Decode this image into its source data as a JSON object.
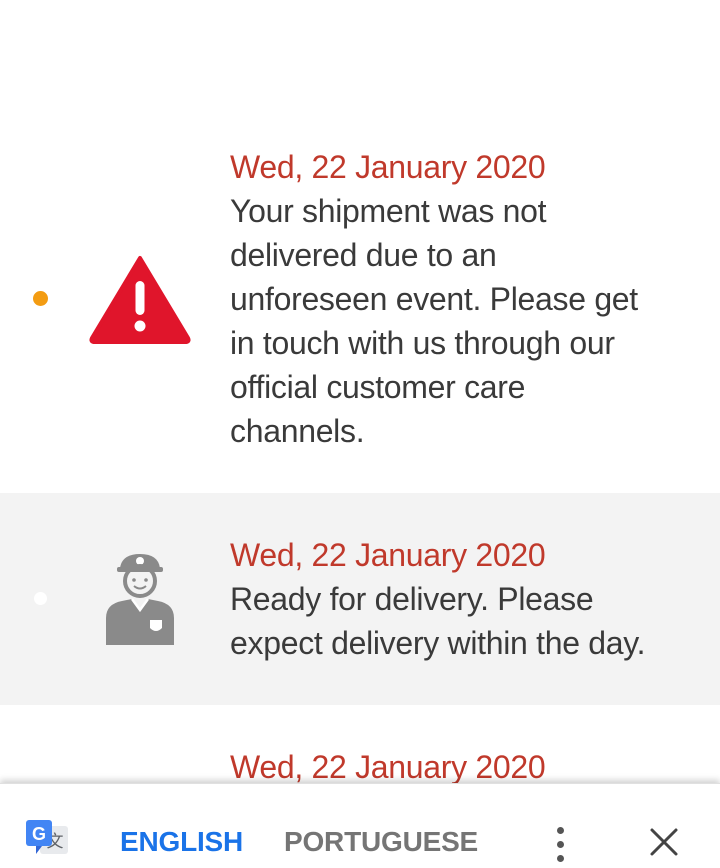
{
  "events": [
    {
      "date": "Wed, 22 January 2020",
      "lines": [
        "Your shipment was not",
        "delivered due to an",
        "unforeseen event. Please get",
        "in touch with us through our",
        "official customer care",
        "channels."
      ],
      "icon": "warning-icon",
      "active": true
    },
    {
      "date": "Wed, 22 January 2020",
      "lines": [
        "Ready for delivery. Please",
        "expect delivery within the day."
      ],
      "icon": "courier-icon",
      "active": false
    },
    {
      "date": "Wed, 22 January 2020",
      "lines": []
    }
  ],
  "translate_bar": {
    "logo_letters": "G",
    "logo_glyph": "文",
    "source_language": "ENGLISH",
    "target_language": "PORTUGUESE",
    "more_icon": "more-vert-icon",
    "close_icon": "close-icon"
  },
  "colors": {
    "date": "#c0392b",
    "text": "#3a3a3a",
    "active_dot": "#f39c12",
    "warning": "#e0152b",
    "selected_language": "#1a73e8",
    "unselected_language": "#757575"
  }
}
